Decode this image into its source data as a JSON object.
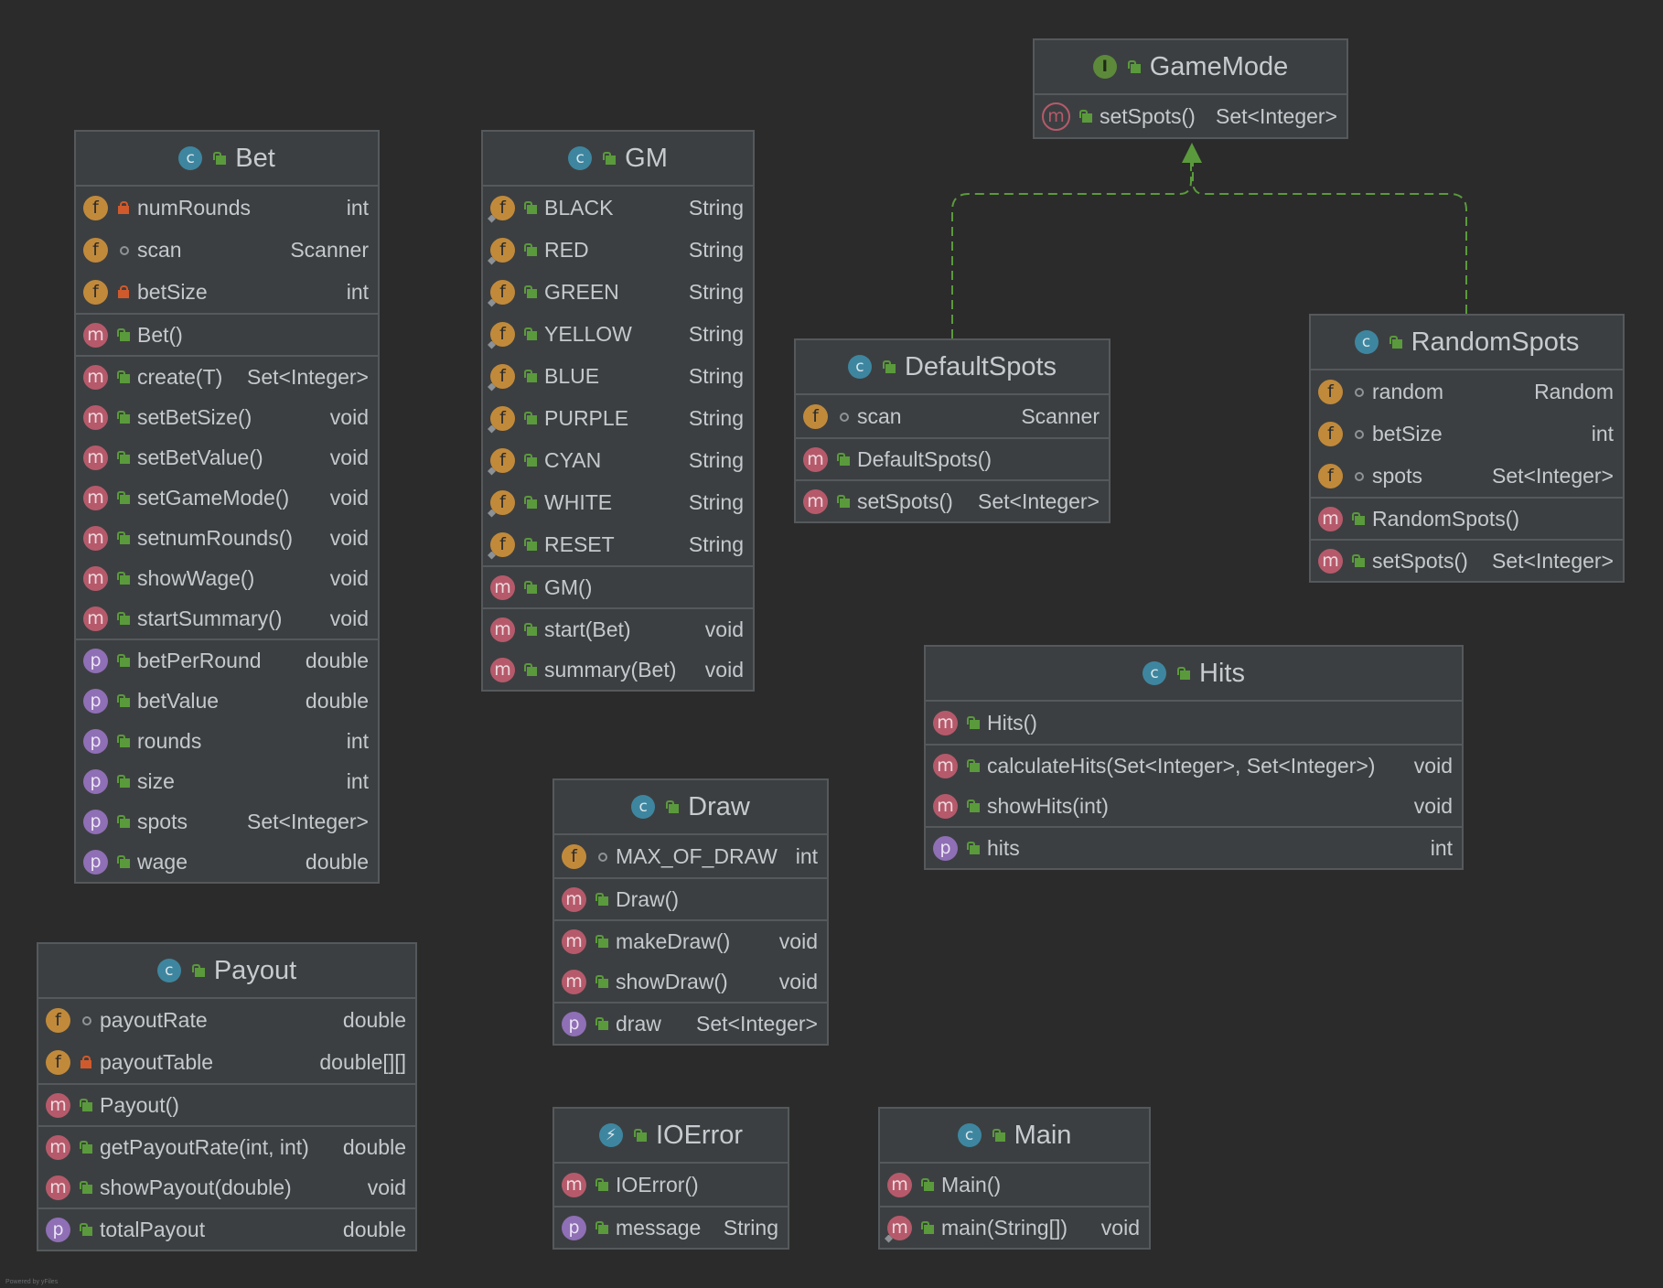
{
  "colors": {
    "background": "#2b2b2b",
    "box": "#3c3f41",
    "border": "#55595c",
    "realization": "#5a9a3c"
  },
  "classes": {
    "gamemode": {
      "title": "GameMode",
      "kind": "I",
      "members": [
        [
          {
            "k": "m",
            "v": "pub",
            "name": "setSpots()",
            "type": "Set<Integer>",
            "abstract": true
          }
        ]
      ]
    },
    "bet": {
      "title": "Bet",
      "kind": "C",
      "members": [
        [
          {
            "k": "f",
            "v": "priv",
            "name": "numRounds",
            "type": "int"
          },
          {
            "k": "f",
            "v": "pkg",
            "name": "scan",
            "type": "Scanner"
          },
          {
            "k": "f",
            "v": "priv",
            "name": "betSize",
            "type": "int"
          }
        ],
        [
          {
            "k": "m",
            "v": "pub",
            "name": "Bet()",
            "type": ""
          }
        ],
        [
          {
            "k": "m",
            "v": "pub",
            "name": "create(T)",
            "type": "Set<Integer>"
          },
          {
            "k": "m",
            "v": "pub",
            "name": "setBetSize()",
            "type": "void"
          },
          {
            "k": "m",
            "v": "pub",
            "name": "setBetValue()",
            "type": "void"
          },
          {
            "k": "m",
            "v": "pub",
            "name": "setGameMode()",
            "type": "void"
          },
          {
            "k": "m",
            "v": "pub",
            "name": "setnumRounds()",
            "type": "void"
          },
          {
            "k": "m",
            "v": "pub",
            "name": "showWage()",
            "type": "void"
          },
          {
            "k": "m",
            "v": "pub",
            "name": "startSummary()",
            "type": "void"
          }
        ],
        [
          {
            "k": "p",
            "v": "pub",
            "name": "betPerRound",
            "type": "double"
          },
          {
            "k": "p",
            "v": "pub",
            "name": "betValue",
            "type": "double"
          },
          {
            "k": "p",
            "v": "pub",
            "name": "rounds",
            "type": "int"
          },
          {
            "k": "p",
            "v": "pub",
            "name": "size",
            "type": "int"
          },
          {
            "k": "p",
            "v": "pub",
            "name": "spots",
            "type": "Set<Integer>"
          },
          {
            "k": "p",
            "v": "pub",
            "name": "wage",
            "type": "double"
          }
        ]
      ]
    },
    "gm": {
      "title": "GM",
      "kind": "C",
      "members": [
        [
          {
            "k": "f",
            "v": "pub",
            "name": "BLACK",
            "type": "String",
            "static": true
          },
          {
            "k": "f",
            "v": "pub",
            "name": "RED",
            "type": "String",
            "static": true
          },
          {
            "k": "f",
            "v": "pub",
            "name": "GREEN",
            "type": "String",
            "static": true
          },
          {
            "k": "f",
            "v": "pub",
            "name": "YELLOW",
            "type": "String",
            "static": true
          },
          {
            "k": "f",
            "v": "pub",
            "name": "BLUE",
            "type": "String",
            "static": true
          },
          {
            "k": "f",
            "v": "pub",
            "name": "PURPLE",
            "type": "String",
            "static": true
          },
          {
            "k": "f",
            "v": "pub",
            "name": "CYAN",
            "type": "String",
            "static": true
          },
          {
            "k": "f",
            "v": "pub",
            "name": "WHITE",
            "type": "String",
            "static": true
          },
          {
            "k": "f",
            "v": "pub",
            "name": "RESET",
            "type": "String",
            "static": true
          }
        ],
        [
          {
            "k": "m",
            "v": "pub",
            "name": "GM()",
            "type": ""
          }
        ],
        [
          {
            "k": "m",
            "v": "pub",
            "name": "start(Bet)",
            "type": "void"
          },
          {
            "k": "m",
            "v": "pub",
            "name": "summary(Bet)",
            "type": "void"
          }
        ]
      ]
    },
    "defaultspots": {
      "title": "DefaultSpots",
      "kind": "C",
      "members": [
        [
          {
            "k": "f",
            "v": "pkg",
            "name": "scan",
            "type": "Scanner"
          }
        ],
        [
          {
            "k": "m",
            "v": "pub",
            "name": "DefaultSpots()",
            "type": ""
          }
        ],
        [
          {
            "k": "m",
            "v": "pub",
            "name": "setSpots()",
            "type": "Set<Integer>"
          }
        ]
      ]
    },
    "randomspots": {
      "title": "RandomSpots",
      "kind": "C",
      "members": [
        [
          {
            "k": "f",
            "v": "pkg",
            "name": "random",
            "type": "Random"
          },
          {
            "k": "f",
            "v": "pkg",
            "name": "betSize",
            "type": "int"
          },
          {
            "k": "f",
            "v": "pkg",
            "name": "spots",
            "type": "Set<Integer>"
          }
        ],
        [
          {
            "k": "m",
            "v": "pub",
            "name": "RandomSpots()",
            "type": ""
          }
        ],
        [
          {
            "k": "m",
            "v": "pub",
            "name": "setSpots()",
            "type": "Set<Integer>"
          }
        ]
      ]
    },
    "hits": {
      "title": "Hits",
      "kind": "C",
      "members": [
        [
          {
            "k": "m",
            "v": "pub",
            "name": "Hits()",
            "type": ""
          }
        ],
        [
          {
            "k": "m",
            "v": "pub",
            "name": "calculateHits(Set<Integer>, Set<Integer>)",
            "type": "void"
          },
          {
            "k": "m",
            "v": "pub",
            "name": "showHits(int)",
            "type": "void"
          }
        ],
        [
          {
            "k": "p",
            "v": "pub",
            "name": "hits",
            "type": "int"
          }
        ]
      ]
    },
    "draw": {
      "title": "Draw",
      "kind": "C",
      "members": [
        [
          {
            "k": "f",
            "v": "pkg",
            "name": "MAX_OF_DRAW",
            "type": "int"
          }
        ],
        [
          {
            "k": "m",
            "v": "pub",
            "name": "Draw()",
            "type": ""
          }
        ],
        [
          {
            "k": "m",
            "v": "pub",
            "name": "makeDraw()",
            "type": "void"
          },
          {
            "k": "m",
            "v": "pub",
            "name": "showDraw()",
            "type": "void"
          }
        ],
        [
          {
            "k": "p",
            "v": "pub",
            "name": "draw",
            "type": "Set<Integer>"
          }
        ]
      ]
    },
    "payout": {
      "title": "Payout",
      "kind": "C",
      "members": [
        [
          {
            "k": "f",
            "v": "pkg",
            "name": "payoutRate",
            "type": "double"
          },
          {
            "k": "f",
            "v": "priv",
            "name": "payoutTable",
            "type": "double[][]"
          }
        ],
        [
          {
            "k": "m",
            "v": "pub",
            "name": "Payout()",
            "type": ""
          }
        ],
        [
          {
            "k": "m",
            "v": "pub",
            "name": "getPayoutRate(int, int)",
            "type": "double"
          },
          {
            "k": "m",
            "v": "pub",
            "name": "showPayout(double)",
            "type": "void"
          }
        ],
        [
          {
            "k": "p",
            "v": "pub",
            "name": "totalPayout",
            "type": "double"
          }
        ]
      ]
    },
    "ioerror": {
      "title": "IOError",
      "kind": "E",
      "members": [
        [
          {
            "k": "m",
            "v": "pub",
            "name": "IOError()",
            "type": ""
          }
        ],
        [
          {
            "k": "p",
            "v": "pub",
            "name": "message",
            "type": "String"
          }
        ]
      ]
    },
    "main": {
      "title": "Main",
      "kind": "C",
      "members": [
        [
          {
            "k": "m",
            "v": "pub",
            "name": "Main()",
            "type": ""
          }
        ],
        [
          {
            "k": "m",
            "v": "pub",
            "name": "main(String[])",
            "type": "void",
            "static": true
          }
        ]
      ]
    }
  },
  "footer": "Powered by yFiles"
}
